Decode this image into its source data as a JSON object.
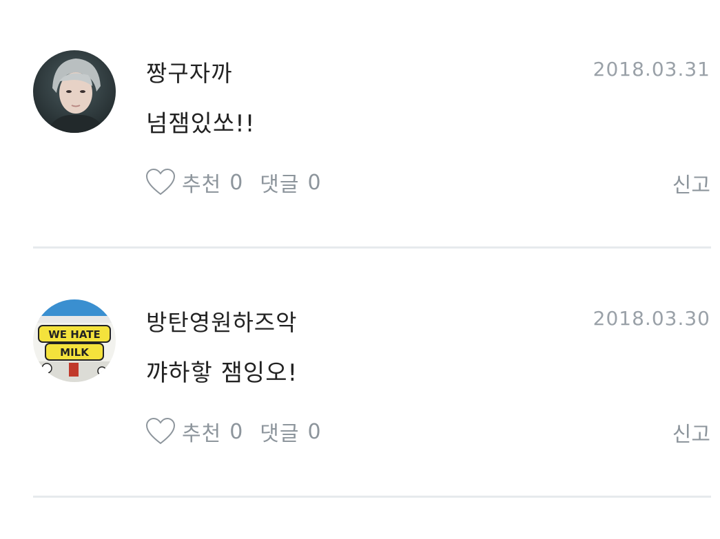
{
  "comments": [
    {
      "username": "짱구자까",
      "date": "2018.03.31",
      "content": "넘잼있쏘!!",
      "like_label": "추천",
      "like_count": "0",
      "reply_label": "댓글",
      "reply_count": "0",
      "report_label": "신고",
      "avatar_icon": "profile-photo"
    },
    {
      "username": "방탄영원하즈악",
      "date": "2018.03.30",
      "content": "꺄하핳 잼잉오!",
      "like_label": "추천",
      "like_count": "0",
      "reply_label": "댓글",
      "reply_count": "0",
      "report_label": "신고",
      "avatar_icon": "profile-image",
      "avatar_text": "WE HATE MILK"
    }
  ],
  "colors": {
    "primary_text": "#222222",
    "secondary_text": "#8d959c",
    "date_text": "#9aa1a8",
    "divider": "#e6eaed"
  }
}
